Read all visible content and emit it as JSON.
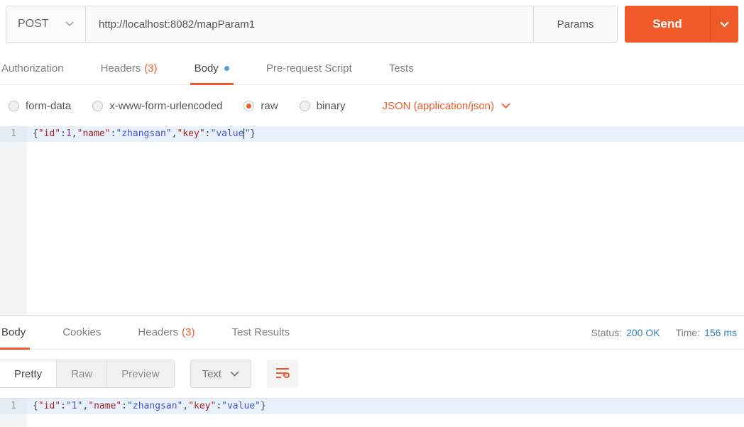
{
  "colors": {
    "accent_orange": "#F05A28",
    "status_blue": "#2D7BC4",
    "body_dot_blue": "#56A0DB",
    "active_line_bg": "#E8F1FB"
  },
  "request_bar": {
    "method": "POST",
    "url": "http://localhost:8082/mapParam1",
    "params_label": "Params",
    "send_label": "Send"
  },
  "request_tabs": {
    "authorization": "Authorization",
    "headers": "Headers",
    "headers_count": "(3)",
    "body": "Body",
    "pre_request": "Pre-request Script",
    "tests": "Tests"
  },
  "body_options": {
    "form_data": "form-data",
    "urlencoded": "x-www-form-urlencoded",
    "raw": "raw",
    "binary": "binary",
    "content_type": "JSON (application/json)"
  },
  "request_editor": {
    "line_number": "1",
    "text": "{\"id\":1,\"name\":\"zhangsan\",\"key\":\"value\"}",
    "tokens": [
      {
        "t": "punc",
        "v": "{"
      },
      {
        "t": "key",
        "v": "\"id\""
      },
      {
        "t": "punc",
        "v": ":"
      },
      {
        "t": "num",
        "v": "1"
      },
      {
        "t": "punc",
        "v": ","
      },
      {
        "t": "key",
        "v": "\"name\""
      },
      {
        "t": "punc",
        "v": ":"
      },
      {
        "t": "str",
        "v": "\"zhangsan\""
      },
      {
        "t": "punc",
        "v": ","
      },
      {
        "t": "key",
        "v": "\"key\""
      },
      {
        "t": "punc",
        "v": ":"
      },
      {
        "t": "str",
        "v": "\"value"
      },
      {
        "t": "cursor",
        "v": ""
      },
      {
        "t": "str",
        "v": "\""
      },
      {
        "t": "punc",
        "v": "}"
      }
    ]
  },
  "response": {
    "tabs": {
      "body": "Body",
      "cookies": "Cookies",
      "headers": "Headers",
      "headers_count": "(3)",
      "test_results": "Test Results"
    },
    "status_label": "Status:",
    "status_value": "200 OK",
    "time_label": "Time:",
    "time_value": "156 ms",
    "toolbar": {
      "pretty": "Pretty",
      "raw": "Raw",
      "preview": "Preview",
      "format": "Text"
    },
    "editor": {
      "line_number": "1",
      "text": "{\"id\":\"1\",\"name\":\"zhangsan\",\"key\":\"value\"}",
      "tokens": [
        {
          "t": "punc",
          "v": "{"
        },
        {
          "t": "key",
          "v": "\"id\""
        },
        {
          "t": "punc",
          "v": ":"
        },
        {
          "t": "str",
          "v": "\"1\""
        },
        {
          "t": "punc",
          "v": ","
        },
        {
          "t": "key",
          "v": "\"name\""
        },
        {
          "t": "punc",
          "v": ":"
        },
        {
          "t": "str",
          "v": "\"zhangsan\""
        },
        {
          "t": "punc",
          "v": ","
        },
        {
          "t": "key",
          "v": "\"key\""
        },
        {
          "t": "punc",
          "v": ":"
        },
        {
          "t": "str",
          "v": "\"value\""
        },
        {
          "t": "punc",
          "v": "}"
        }
      ]
    }
  }
}
